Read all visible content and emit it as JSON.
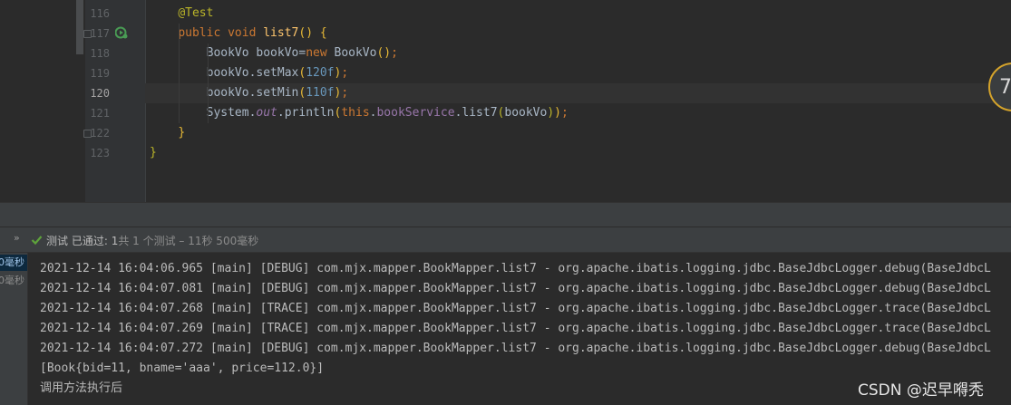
{
  "editor": {
    "lines": [
      {
        "num": "116",
        "tokens": [
          {
            "t": "    "
          },
          {
            "t": "@Test",
            "c": "an"
          }
        ]
      },
      {
        "num": "117",
        "tokens": [
          {
            "t": "    "
          },
          {
            "t": "public void ",
            "c": "kw"
          },
          {
            "t": "list7",
            "c": "fn"
          },
          {
            "t": "() {",
            "c": "par"
          }
        ]
      },
      {
        "num": "118",
        "tokens": [
          {
            "t": "        BookVo bookVo="
          },
          {
            "t": "new ",
            "c": "kw"
          },
          {
            "t": "BookVo"
          },
          {
            "t": "()",
            "c": "par"
          },
          {
            "t": ";",
            "c": "kw"
          }
        ]
      },
      {
        "num": "119",
        "tokens": [
          {
            "t": "        bookVo.setMax"
          },
          {
            "t": "(",
            "c": "par"
          },
          {
            "t": "120f",
            "c": "num"
          },
          {
            "t": ")",
            "c": "par"
          },
          {
            "t": ";",
            "c": "kw"
          }
        ]
      },
      {
        "num": "120",
        "tokens": [
          {
            "t": "        bookVo.setMin"
          },
          {
            "t": "(",
            "c": "par"
          },
          {
            "t": "110f",
            "c": "num"
          },
          {
            "t": ")",
            "c": "par"
          },
          {
            "t": ";",
            "c": "kw"
          }
        ]
      },
      {
        "num": "121",
        "tokens": [
          {
            "t": "        System."
          },
          {
            "t": "out",
            "c": "it"
          },
          {
            "t": ".println"
          },
          {
            "t": "(",
            "c": "par"
          },
          {
            "t": "this",
            "c": "kw"
          },
          {
            "t": "."
          },
          {
            "t": "bookService",
            "c": "fld"
          },
          {
            "t": ".list7"
          },
          {
            "t": "(",
            "c": "br"
          },
          {
            "t": "bookVo"
          },
          {
            "t": ")",
            "c": "br"
          },
          {
            "t": ")",
            "c": "par"
          },
          {
            "t": ";",
            "c": "kw"
          }
        ]
      },
      {
        "num": "122",
        "tokens": [
          {
            "t": "    "
          },
          {
            "t": "}",
            "c": "par"
          }
        ]
      },
      {
        "num": "123",
        "tokens": [
          {
            "t": "}",
            "c": "an"
          }
        ]
      }
    ],
    "current_line": "120",
    "badge_text": "7"
  },
  "test_toolbar": {
    "expand_glyph": "»",
    "status_label": "测试 已通过: ",
    "status_count": "1",
    "status_detail": "共 1 个测试 – 11秒 500毫秒"
  },
  "tree": {
    "rows": [
      "0毫秒",
      "0毫秒"
    ]
  },
  "console": {
    "lines": [
      "2021-12-14 16:04:06.965 [main] [DEBUG] com.mjx.mapper.BookMapper.list7 - org.apache.ibatis.logging.jdbc.BaseJdbcLogger.debug(BaseJdbcL",
      "2021-12-14 16:04:07.081 [main] [DEBUG] com.mjx.mapper.BookMapper.list7 - org.apache.ibatis.logging.jdbc.BaseJdbcLogger.debug(BaseJdbcL",
      "2021-12-14 16:04:07.268 [main] [TRACE] com.mjx.mapper.BookMapper.list7 - org.apache.ibatis.logging.jdbc.BaseJdbcLogger.trace(BaseJdbcL",
      "2021-12-14 16:04:07.269 [main] [TRACE] com.mjx.mapper.BookMapper.list7 - org.apache.ibatis.logging.jdbc.BaseJdbcLogger.trace(BaseJdbcL",
      "2021-12-14 16:04:07.272 [main] [DEBUG] com.mjx.mapper.BookMapper.list7 - org.apache.ibatis.logging.jdbc.BaseJdbcLogger.debug(BaseJdbcL",
      "[Book{bid=11, bname='aaa', price=112.0}]",
      "调用方法执行后"
    ]
  },
  "watermark": "CSDN @迟早嘚秃"
}
